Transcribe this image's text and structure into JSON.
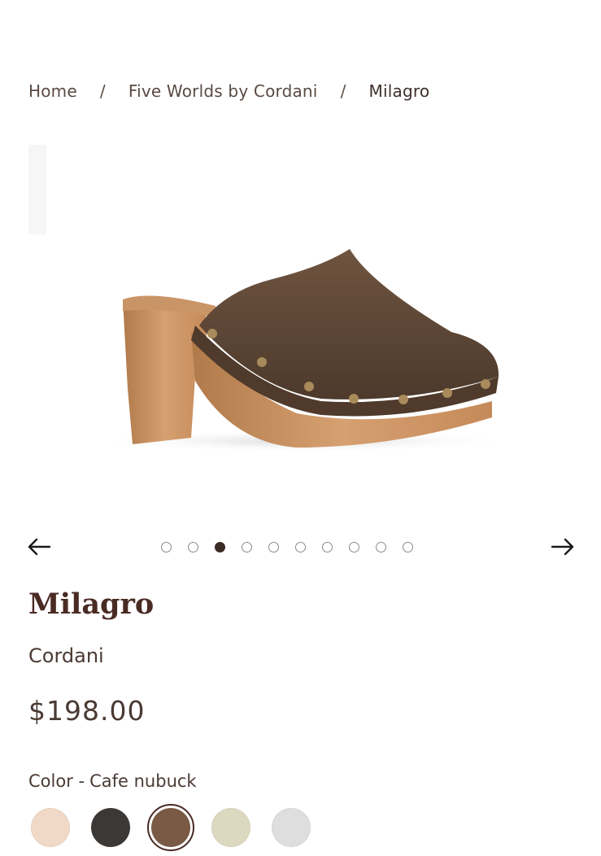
{
  "breadcrumb": {
    "home": "Home",
    "separator": "/",
    "collection": "Five Worlds by Cordani",
    "current": "Milagro"
  },
  "gallery": {
    "image": "brown-nubuck-clog-with-wooden-heel",
    "total_images": 10,
    "active_index": 2,
    "prev_icon": "arrow-left-icon",
    "next_icon": "arrow-right-icon"
  },
  "product": {
    "title": "Milagro",
    "brand": "Cordani",
    "price": "$198.00"
  },
  "color": {
    "label": "Color -",
    "selected": "Cafe nubuck",
    "swatches": [
      {
        "color": "#f0d9c6"
      },
      {
        "color": "#3c3836"
      },
      {
        "color": "#7a5a44",
        "selected": true
      },
      {
        "color": "#ddd8c0"
      },
      {
        "color": "#dedede"
      }
    ]
  }
}
